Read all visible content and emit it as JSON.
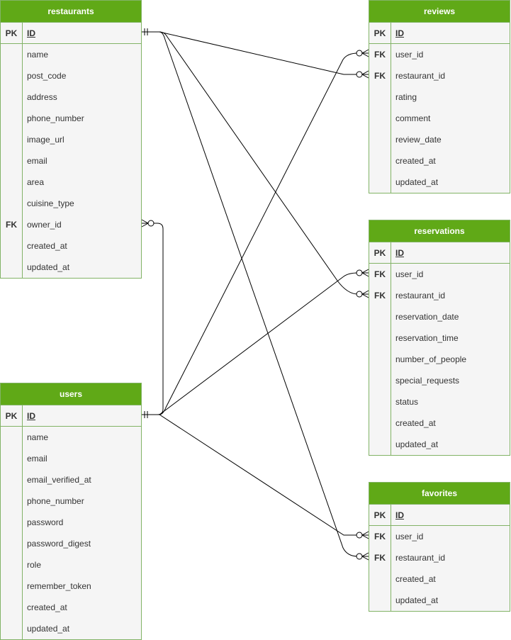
{
  "entities": {
    "restaurants": {
      "title": "restaurants",
      "pk": {
        "key": "PK",
        "name": "ID"
      },
      "fields": [
        {
          "key": "",
          "name": "name"
        },
        {
          "key": "",
          "name": "post_code"
        },
        {
          "key": "",
          "name": "address"
        },
        {
          "key": "",
          "name": "phone_number"
        },
        {
          "key": "",
          "name": "image_url"
        },
        {
          "key": "",
          "name": "email"
        },
        {
          "key": "",
          "name": "area"
        },
        {
          "key": "",
          "name": "cuisine_type"
        },
        {
          "key": "FK",
          "name": "owner_id"
        },
        {
          "key": "",
          "name": "created_at"
        },
        {
          "key": "",
          "name": "updated_at"
        }
      ]
    },
    "users": {
      "title": "users",
      "pk": {
        "key": "PK",
        "name": "ID"
      },
      "fields": [
        {
          "key": "",
          "name": "name"
        },
        {
          "key": "",
          "name": "email"
        },
        {
          "key": "",
          "name": "email_verified_at"
        },
        {
          "key": "",
          "name": "phone_number"
        },
        {
          "key": "",
          "name": "password"
        },
        {
          "key": "",
          "name": "password_digest"
        },
        {
          "key": "",
          "name": "role"
        },
        {
          "key": "",
          "name": "remember_token"
        },
        {
          "key": "",
          "name": "created_at"
        },
        {
          "key": "",
          "name": "updated_at"
        }
      ]
    },
    "reviews": {
      "title": "reviews",
      "pk": {
        "key": "PK",
        "name": "ID"
      },
      "fields": [
        {
          "key": "FK",
          "name": "user_id"
        },
        {
          "key": "FK",
          "name": "restaurant_id"
        },
        {
          "key": "",
          "name": "rating"
        },
        {
          "key": "",
          "name": "comment"
        },
        {
          "key": "",
          "name": "review_date"
        },
        {
          "key": "",
          "name": "created_at"
        },
        {
          "key": "",
          "name": "updated_at"
        }
      ]
    },
    "reservations": {
      "title": "reservations",
      "pk": {
        "key": "PK",
        "name": "ID"
      },
      "fields": [
        {
          "key": "FK",
          "name": "user_id"
        },
        {
          "key": "FK",
          "name": "restaurant_id"
        },
        {
          "key": "",
          "name": "reservation_date"
        },
        {
          "key": "",
          "name": "reservation_time"
        },
        {
          "key": "",
          "name": "number_of_people"
        },
        {
          "key": "",
          "name": "special_requests"
        },
        {
          "key": "",
          "name": "status"
        },
        {
          "key": "",
          "name": "created_at"
        },
        {
          "key": "",
          "name": "updated_at"
        }
      ]
    },
    "favorites": {
      "title": "favorites",
      "pk": {
        "key": "PK",
        "name": "ID"
      },
      "fields": [
        {
          "key": "FK",
          "name": "user_id"
        },
        {
          "key": "FK",
          "name": "restaurant_id"
        },
        {
          "key": "",
          "name": "created_at"
        },
        {
          "key": "",
          "name": "updated_at"
        }
      ]
    }
  },
  "relationships": [
    {
      "from": "users.ID",
      "to": "restaurants.owner_id",
      "type": "one-to-many"
    },
    {
      "from": "users.ID",
      "to": "reviews.user_id",
      "type": "one-to-many"
    },
    {
      "from": "restaurants.ID",
      "to": "reviews.restaurant_id",
      "type": "one-to-many"
    },
    {
      "from": "users.ID",
      "to": "reservations.user_id",
      "type": "one-to-many"
    },
    {
      "from": "restaurants.ID",
      "to": "reservations.restaurant_id",
      "type": "one-to-many"
    },
    {
      "from": "users.ID",
      "to": "favorites.user_id",
      "type": "one-to-many"
    },
    {
      "from": "restaurants.ID",
      "to": "favorites.restaurant_id",
      "type": "one-to-many"
    }
  ],
  "colors": {
    "header": "#60a917",
    "border": "#82b366",
    "body": "#f5f5f5",
    "line": "#000000"
  }
}
